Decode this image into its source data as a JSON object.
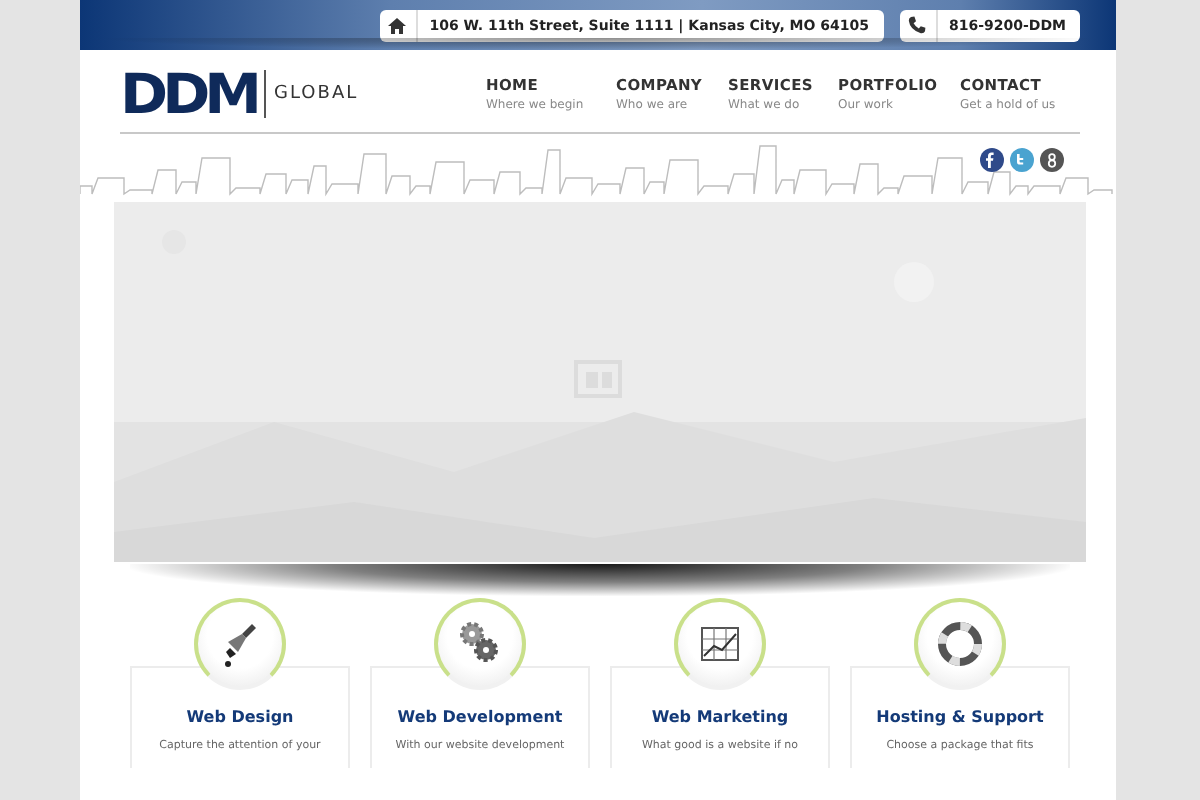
{
  "top_bar": {
    "address": "106 W. 11th Street, Suite 1111 | Kansas City, MO 64105",
    "phone": "816-9200-DDM"
  },
  "logo": {
    "mark": "DDM",
    "text": "GLOBAL"
  },
  "nav": [
    {
      "label": "HOME",
      "subtitle": "Where we begin"
    },
    {
      "label": "COMPANY",
      "subtitle": "Who we are"
    },
    {
      "label": "SERVICES",
      "subtitle": "What we do"
    },
    {
      "label": "PORTFOLIO",
      "subtitle": "Our work"
    },
    {
      "label": "CONTACT",
      "subtitle": "Get a hold of us"
    }
  ],
  "social": [
    {
      "kind": "facebook",
      "color": "#2f4a8a"
    },
    {
      "kind": "twitter",
      "color": "#4aa3d0"
    },
    {
      "kind": "google",
      "color": "#555555"
    }
  ],
  "services": [
    {
      "kind": "brush",
      "title": "Web Design",
      "description": "Capture the attention of your"
    },
    {
      "kind": "gears",
      "title": "Web Development",
      "description": "With our website development"
    },
    {
      "kind": "chart",
      "title": "Web Marketing",
      "description": "What good is a website if no"
    },
    {
      "kind": "lifebuoy",
      "title": "Hosting & Support",
      "description": "Choose a package that fits"
    }
  ]
}
